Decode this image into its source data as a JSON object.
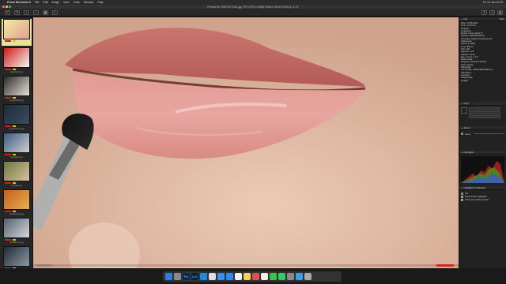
{
  "menubar": {
    "app_name": "Photo Mechanic 6",
    "items": [
      "File",
      "Edit",
      "Image",
      "View",
      "Tools",
      "Window",
      "Help"
    ],
    "clock": "Fri 14 Jan 11:34"
  },
  "window": {
    "title": "Preview for THEPHOTO#4.jpg, JPG (3790 x 6948) 3789x2 100% ZOOM (1 of 70)"
  },
  "filmstrip": {
    "items": [
      {
        "name": "",
        "colors": [
          "#f4e9a4",
          "#e0a090"
        ],
        "selected": true
      },
      {
        "name": "lipstickred.jpg",
        "colors": [
          "#d01818",
          "#f5f5f5"
        ],
        "selected": false
      },
      {
        "name": "couplebride.jpg",
        "colors": [
          "#2a2a2a",
          "#e8e0d8"
        ],
        "selected": false
      },
      {
        "name": "architectureA.jpg",
        "colors": [
          "#1d2c3a",
          "#3a4c5e"
        ],
        "selected": false
      },
      {
        "name": "cityskyline.jpg",
        "colors": [
          "#3a5a80",
          "#d0d0d0"
        ],
        "selected": false
      },
      {
        "name": "portraitA.jpg",
        "colors": [
          "#6a7a40",
          "#d8c0a0"
        ],
        "selected": false
      },
      {
        "name": "streetpeople.jpg",
        "colors": [
          "#c06020",
          "#e8b050"
        ],
        "selected": false
      },
      {
        "name": "bridalshoot.jpg",
        "colors": [
          "#506070",
          "#d8d8d8"
        ],
        "selected": false
      },
      {
        "name": "",
        "colors": [
          "#202a30",
          "#8a9aa8"
        ],
        "selected": false
      }
    ]
  },
  "panel": {
    "info_title": "Info",
    "info_lines": [
      "Date: 14.08.2021",
      "Time: 13:10:44",
      "Latitude:",
      "Longitude:",
      "Model: Canon EOS R",
      "Serial #: 008023002072",
      "Firmware: Adobe Photoshop 22",
      "Sharpness:",
      "Frame #: 6804",
      "Lens: 85mm",
      "ISO: 100",
      "Aperture: 1.8",
      "Shutter: 1/125",
      "Exp. Comp.: +0.3",
      "Flash Used:",
      "Program: Aperture Priority",
      "Focus Mode:",
      "White Bal:",
      "ICC Profile: sRGB IEC61966-2.1",
      "Saturation:",
      "Contrast:",
      "Sharpening:",
      "Quality:"
    ],
    "crop_title": "Crop",
    "crop_buttons": [
      "Crop",
      "Reset",
      "Settings"
    ],
    "zones_title": "Zones",
    "zoom_label": "Zoom",
    "histogram_title": "Histogram",
    "highlights_title": "Highlights & Shadows",
    "hl_options": [
      "Off",
      "Show blown highlights",
      "Show lost shadow detail"
    ],
    "tools_label": "Tools"
  },
  "dock": {
    "icons": [
      {
        "name": "finder-icon",
        "label": "",
        "color": "#2d7ce0"
      },
      {
        "name": "launchpad-icon",
        "label": "",
        "color": "#8a8a8a"
      },
      {
        "name": "photoshop-icon",
        "label": "Ps",
        "color": "#0b2a4a"
      },
      {
        "name": "lightroom-icon",
        "label": "LrC",
        "color": "#0a2238"
      },
      {
        "name": "safari-icon",
        "label": "",
        "color": "#1a8ae6"
      },
      {
        "name": "chrome-icon",
        "label": "",
        "color": "#e0e0e0"
      },
      {
        "name": "mail-icon",
        "label": "",
        "color": "#3a8ef0"
      },
      {
        "name": "appstore-icon",
        "label": "",
        "color": "#2a8cf0"
      },
      {
        "name": "calendar-icon",
        "label": "",
        "color": "#f2f2f2"
      },
      {
        "name": "notes-icon",
        "label": "",
        "color": "#f5d34a"
      },
      {
        "name": "music-icon",
        "label": "",
        "color": "#f2455a"
      },
      {
        "name": "photos-icon",
        "label": "",
        "color": "#f0f0f0"
      },
      {
        "name": "messages-icon",
        "label": "",
        "color": "#36c44a"
      },
      {
        "name": "whatsapp-icon",
        "label": "",
        "color": "#25d366"
      },
      {
        "name": "settings-icon",
        "label": "",
        "color": "#8a8a8a"
      },
      {
        "name": "folder-icon",
        "label": "",
        "color": "#3aa0e8"
      },
      {
        "name": "trash-icon",
        "label": "",
        "color": "#aaaaaa"
      }
    ]
  },
  "colors": {
    "tag_red": "#c8202a",
    "tag_yellow": "#e6c600",
    "scroll_red": "#dd2222",
    "selected_thumb": "#e8e39a"
  }
}
